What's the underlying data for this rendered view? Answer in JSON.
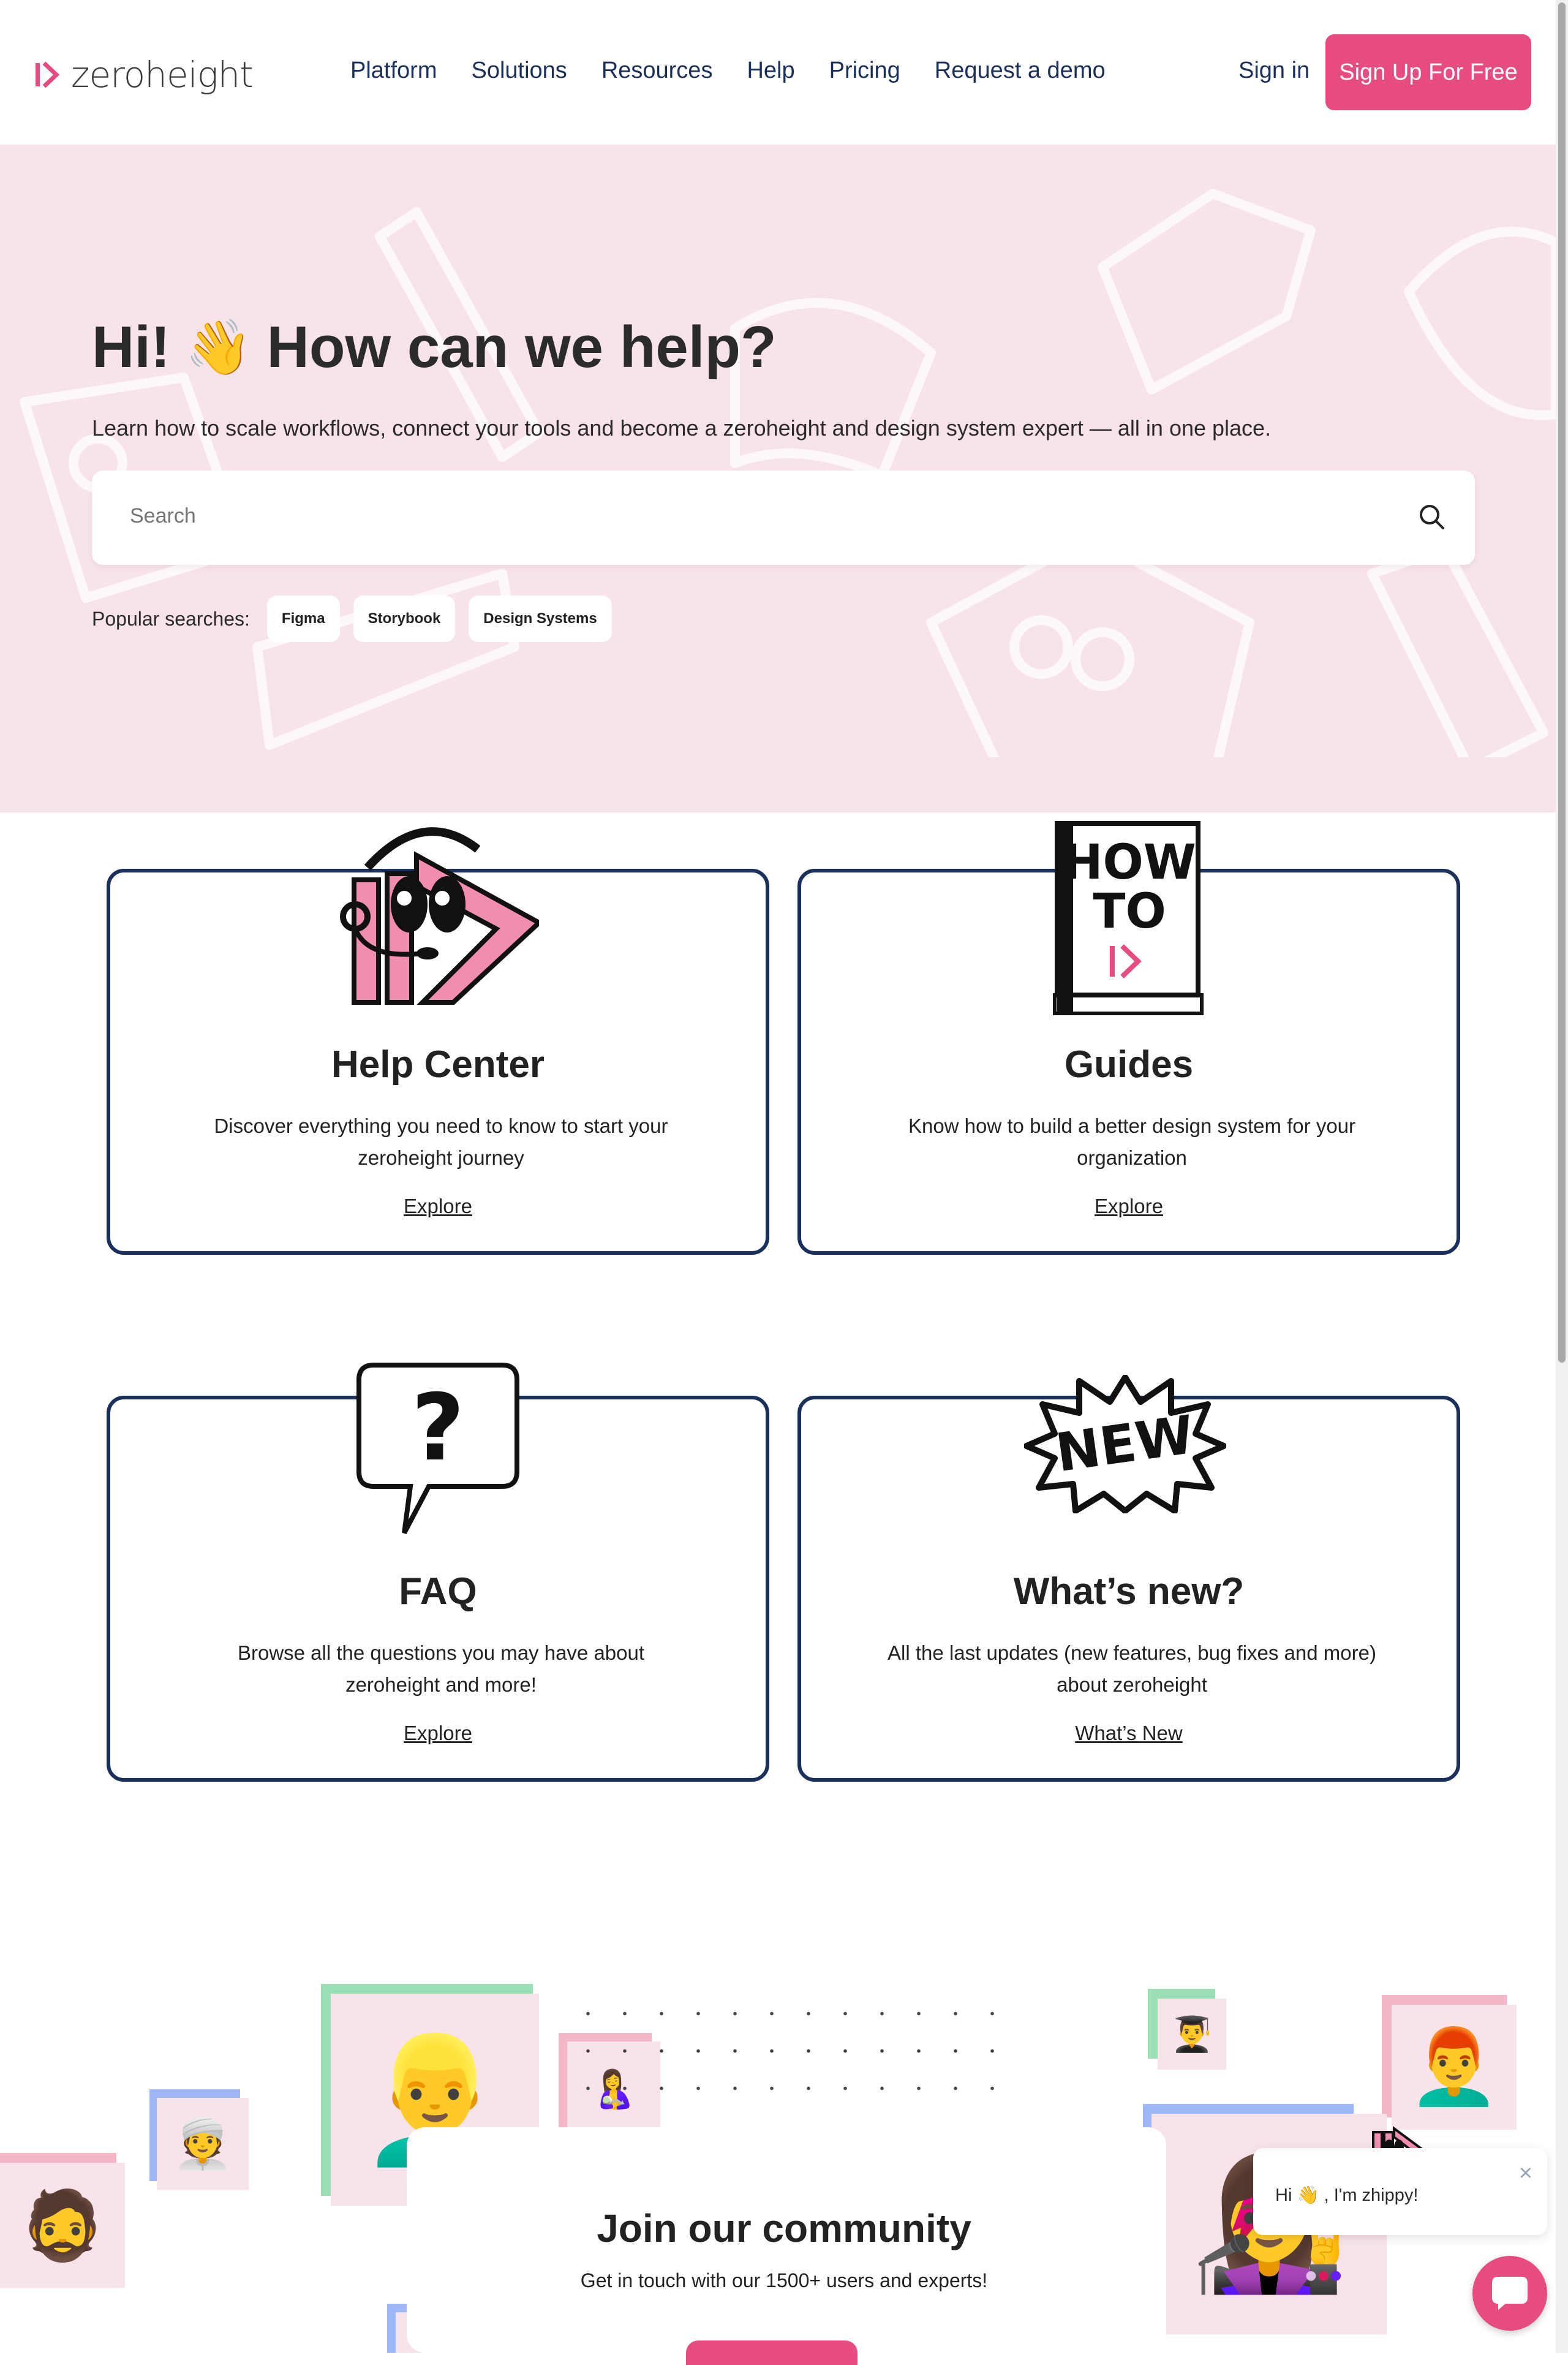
{
  "header": {
    "logo_text": "zeroheight",
    "nav": [
      "Platform",
      "Solutions",
      "Resources",
      "Help",
      "Pricing",
      "Request a demo"
    ],
    "sign_in": "Sign in",
    "sign_up": "Sign Up For Free"
  },
  "hero": {
    "title_pre": "Hi!",
    "title_emoji": "👋",
    "title_post": "How can we help?",
    "subtitle": "Learn how to scale workflows, connect your tools and become a zeroheight and design system expert — all in one place.",
    "search_placeholder": "Search",
    "popular_label": "Popular searches:",
    "popular": [
      "Figma",
      "Storybook",
      "Design Systems"
    ]
  },
  "cards": [
    {
      "title": "Help Center",
      "desc": "Discover everything you need to know to start your zeroheight journey",
      "link": "Explore"
    },
    {
      "title": "Guides",
      "desc": "Know how to build a better design system for your organization",
      "link": "Explore",
      "art_text_1": "HOW",
      "art_text_2": "TO"
    },
    {
      "title": "FAQ",
      "desc": "Browse all the questions you may have about zeroheight and more!",
      "link": "Explore",
      "art_text": "?"
    },
    {
      "title": "What’s new?",
      "desc": "All the last updates (new features, bug fixes and more) about zeroheight",
      "link": "What’s New",
      "art_text": "NEW"
    }
  ],
  "community": {
    "title": "Join our community",
    "subtitle": "Get in touch with our 1500+ users and experts!"
  },
  "chat": {
    "greeting": "Hi 👋 , I'm zhippy!",
    "close": "×"
  },
  "colors": {
    "brand_pink": "#e64c80",
    "navy": "#1b2f5c",
    "hero_bg": "#f9e3ea"
  },
  "icons": [
    "logo-icon",
    "search-icon",
    "close-icon",
    "chat-icon"
  ]
}
